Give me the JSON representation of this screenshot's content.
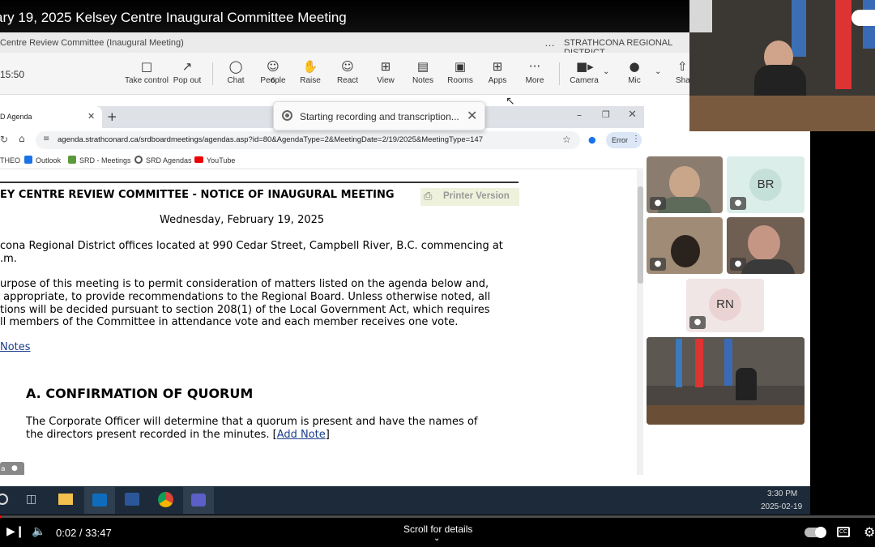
{
  "video": {
    "title": "ary 19, 2025 Kelsey Centre Inaugural Committee Meeting"
  },
  "teams": {
    "meeting_name": "Centre Review Committee (Inaugural Meeting)",
    "org": "STRATHCONA REGIONAL DISTRICT",
    "more": "…",
    "timer": "15:50",
    "toolbar": [
      {
        "label": "Take control",
        "icon": "take-control-icon"
      },
      {
        "label": "Pop out",
        "icon": "pop-out-icon"
      },
      {
        "label": "Chat",
        "icon": "chat-icon"
      },
      {
        "label": "People",
        "icon": "people-icon",
        "count": "6"
      },
      {
        "label": "Raise",
        "icon": "raise-hand-icon"
      },
      {
        "label": "React",
        "icon": "react-icon"
      },
      {
        "label": "View",
        "icon": "view-icon"
      },
      {
        "label": "Notes",
        "icon": "notes-icon"
      },
      {
        "label": "Rooms",
        "icon": "rooms-icon"
      },
      {
        "label": "Apps",
        "icon": "apps-icon"
      },
      {
        "label": "More",
        "icon": "more-icon"
      },
      {
        "label": "Camera",
        "icon": "camera-icon"
      },
      {
        "label": "Mic",
        "icon": "mic-icon"
      },
      {
        "label": "Sha",
        "icon": "share-icon"
      }
    ],
    "recording_toast": "Starting recording and transcription..."
  },
  "browser": {
    "tab_title": "D Agenda",
    "url": "agenda.strathconard.ca/srdboardmeetings/agendas.asp?id=80&AgendaType=2&MeetingDate=2/19/2025&MeetingType=147",
    "error_label": "Error",
    "bookmarks": [
      "THEO",
      "Outlook",
      "SRD - Meetings",
      "SRD Agendas",
      "YouTube"
    ]
  },
  "document": {
    "heading": "EY CENTRE REVIEW COMMITTEE - NOTICE OF INAUGURAL MEETING",
    "printer_version": "Printer Version",
    "date": "Wednesday, February 19, 2025",
    "location_line1": "cona Regional District offices located at 990 Cedar Street, Campbell River, B.C. commencing at",
    "location_line2": ".m.",
    "purpose_line1": "urpose of this meeting is to permit consideration of matters listed on the agenda below and,",
    "purpose_line2": " appropriate, to provide recommendations to the Regional Board. Unless otherwise noted, all",
    "purpose_line3": "tions will be decided pursuant to section 208(1) of the Local Government Act, which requires",
    "purpose_line4": "ll members of the Committee in attendance vote and each member receives one vote.",
    "notes_link": "Notes",
    "section_a": "A. CONFIRMATION OF QUORUM",
    "quorum_line1": "The Corporate Officer will determine that a quorum is present and have the names of",
    "quorum_line2": "the directors present recorded in the minutes. [",
    "add_note": "Add Note",
    "quorum_close": "]",
    "bottom_badge": "a"
  },
  "participants": [
    {
      "type": "video",
      "desc": "woman"
    },
    {
      "type": "avatar",
      "initials": "BR",
      "color": "#d8ebe7"
    },
    {
      "type": "video",
      "desc": "person-dark"
    },
    {
      "type": "video",
      "desc": "woman-glasses"
    },
    {
      "type": "avatar",
      "initials": "RN",
      "color": "#e8d8d8"
    },
    {
      "type": "video",
      "desc": "room"
    }
  ],
  "taskbar": {
    "time": "3:30 PM",
    "date": "2025-02-19"
  },
  "youtube": {
    "time": "0:02 / 33:47",
    "scroll_hint": "Scroll for details",
    "progress_fraction": 0.001
  }
}
